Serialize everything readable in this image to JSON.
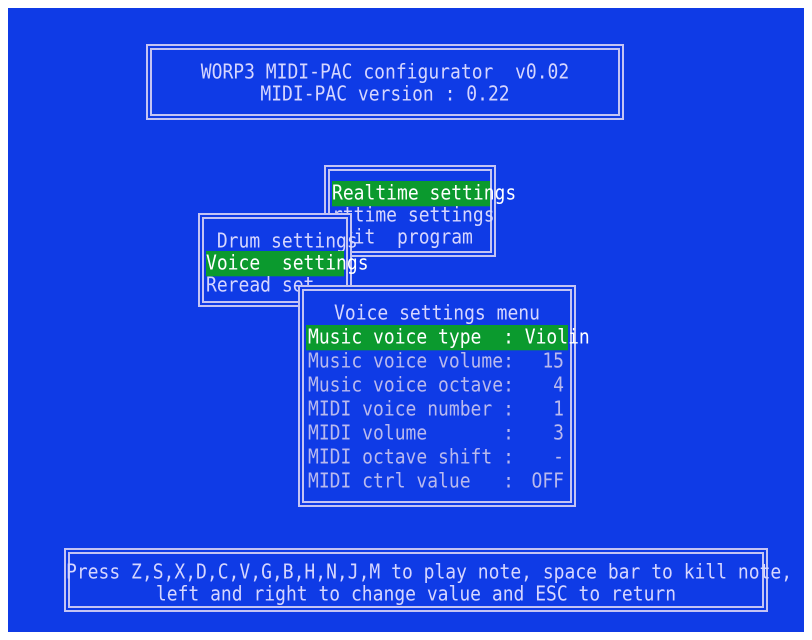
{
  "title_box": {
    "line1": "WORP3 MIDI-PAC configurator  v0.02",
    "line2": "MIDI-PAC version : 0.22"
  },
  "main_menu": {
    "items": [
      {
        "label": "Realtime settings",
        "selected": true
      },
      {
        "label": "rttime settings",
        "selected": false
      },
      {
        "label": "Exit  program",
        "selected": false
      }
    ]
  },
  "sub_menu": {
    "items": [
      {
        "label": " Drum settings",
        "selected": false
      },
      {
        "label": "Voice  settings",
        "selected": true
      },
      {
        "label": "Reread set",
        "selected": false
      }
    ]
  },
  "voice_panel": {
    "heading": "Voice settings menu",
    "rows": [
      {
        "label": "Music voice type  : Violin",
        "value": "",
        "selected": true
      },
      {
        "label": "Music voice volume:",
        "value": "15",
        "selected": false
      },
      {
        "label": "Music voice octave:",
        "value": "4",
        "selected": false
      },
      {
        "label": "MIDI voice number :",
        "value": "1",
        "selected": false
      },
      {
        "label": "MIDI volume       :",
        "value": "3",
        "selected": false
      },
      {
        "label": "MIDI octave shift :",
        "value": "-",
        "selected": false
      },
      {
        "label": "MIDI ctrl value   :",
        "value": "OFF",
        "selected": false
      }
    ]
  },
  "footer": {
    "line1": "Press Z,S,X,D,C,V,G,B,H,N,J,M to play note, space bar to kill note,",
    "line2": "left and right to change value and ESC to return"
  },
  "colors": {
    "background": "#0f3be6",
    "text": "#d6d6ff",
    "selection": "#0b9a2e",
    "border": "#c4c4f4"
  }
}
